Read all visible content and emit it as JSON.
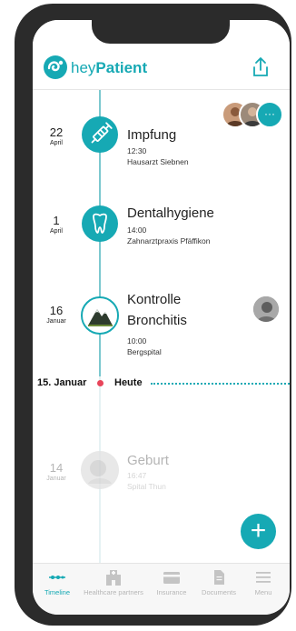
{
  "app": {
    "brand_prefix": "hey",
    "brand_name": "Patient"
  },
  "colors": {
    "accent": "#16a9b4",
    "today_dot": "#e8455a",
    "faded": "#b5b5b5"
  },
  "timeline": {
    "events": [
      {
        "day": "22",
        "month": "April",
        "title": "Impfung",
        "time": "12:30",
        "place": "Hausarzt Siebnen",
        "icon": "syringe-icon"
      },
      {
        "day": "1",
        "month": "April",
        "title": "Dentalhygiene",
        "time": "14:00",
        "place": "Zahnarztpraxis Pfäffikon",
        "icon": "tooth-icon"
      },
      {
        "day": "16",
        "month": "Januar",
        "title_line1": "Kontrolle",
        "title_line2": "Bronchitis",
        "time": "10:00",
        "place": "Bergspital",
        "icon": "mountain-icon"
      }
    ],
    "today": {
      "date": "15. Januar",
      "label": "Heute"
    },
    "past": {
      "day": "14",
      "month": "Januar",
      "title": "Geburt",
      "time": "16:47",
      "place": "Spital Thun",
      "icon": "baby-photo-icon"
    },
    "more_label": "···"
  },
  "fab": {
    "label": "+"
  },
  "nav": {
    "items": [
      {
        "label": "Timeline",
        "icon": "timeline-icon",
        "active": true
      },
      {
        "label": "Healthcare partners",
        "icon": "hospital-icon",
        "active": false
      },
      {
        "label": "Insurance",
        "icon": "card-icon",
        "active": false
      },
      {
        "label": "Documents",
        "icon": "document-icon",
        "active": false
      },
      {
        "label": "Menu",
        "icon": "menu-icon",
        "active": false
      }
    ]
  }
}
